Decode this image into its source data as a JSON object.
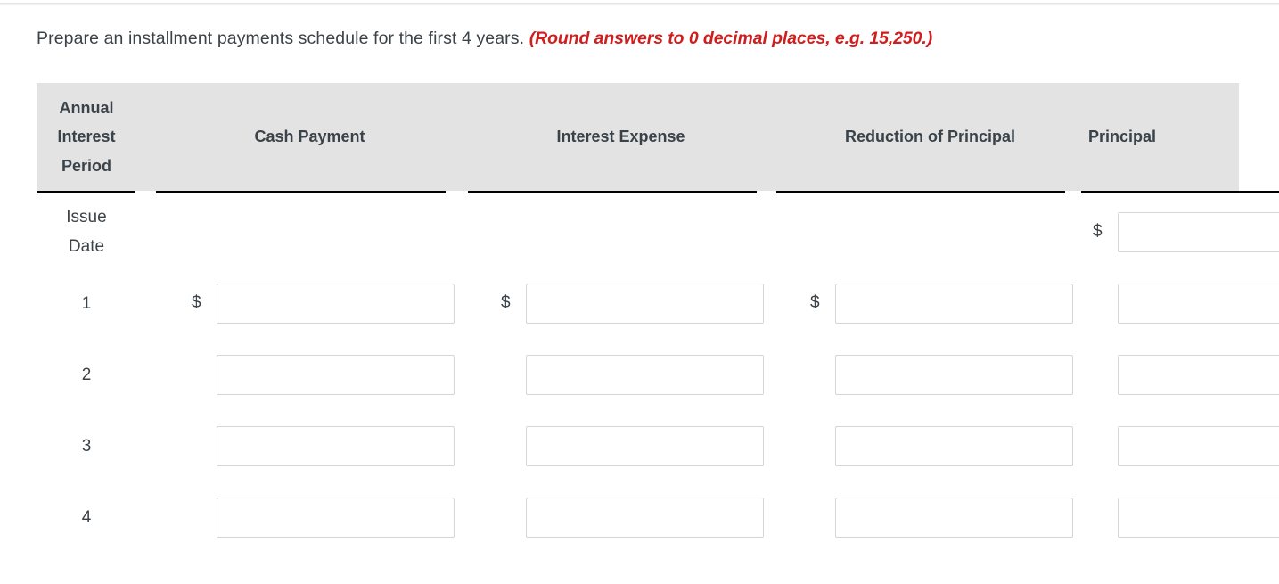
{
  "prompt": {
    "text": "Prepare an installment payments schedule for the first 4 years.",
    "note": "(Round answers to 0 decimal places, e.g. 15,250.)",
    "note_color": "#d01e1e"
  },
  "table": {
    "header_background": "#e3e3e3",
    "columns": [
      {
        "id": "period",
        "label": "Annual\nInterest\nPeriod",
        "lines": [
          "Annual",
          "Interest",
          "Period"
        ]
      },
      {
        "id": "cash",
        "label": "Cash Payment"
      },
      {
        "id": "interest",
        "label": "Interest Expense"
      },
      {
        "id": "reduction",
        "label": "Reduction of Principal"
      },
      {
        "id": "principal",
        "label": "Principal"
      }
    ],
    "rows": [
      {
        "label_lines": [
          "Issue",
          "Date"
        ],
        "cells": [
          {
            "column": "cash",
            "has_dollar": false,
            "has_input": false,
            "value": ""
          },
          {
            "column": "interest",
            "has_dollar": false,
            "has_input": false,
            "value": ""
          },
          {
            "column": "reduction",
            "has_dollar": false,
            "has_input": false,
            "value": ""
          },
          {
            "column": "principal",
            "has_dollar": true,
            "has_input": true,
            "value": ""
          }
        ]
      },
      {
        "label_lines": [
          "1"
        ],
        "cells": [
          {
            "column": "cash",
            "has_dollar": true,
            "has_input": true,
            "value": ""
          },
          {
            "column": "interest",
            "has_dollar": true,
            "has_input": true,
            "value": ""
          },
          {
            "column": "reduction",
            "has_dollar": true,
            "has_input": true,
            "value": ""
          },
          {
            "column": "principal",
            "has_dollar": false,
            "has_input": true,
            "value": ""
          }
        ]
      },
      {
        "label_lines": [
          "2"
        ],
        "cells": [
          {
            "column": "cash",
            "has_dollar": false,
            "has_input": true,
            "value": ""
          },
          {
            "column": "interest",
            "has_dollar": false,
            "has_input": true,
            "value": ""
          },
          {
            "column": "reduction",
            "has_dollar": false,
            "has_input": true,
            "value": ""
          },
          {
            "column": "principal",
            "has_dollar": false,
            "has_input": true,
            "value": ""
          }
        ]
      },
      {
        "label_lines": [
          "3"
        ],
        "cells": [
          {
            "column": "cash",
            "has_dollar": false,
            "has_input": true,
            "value": ""
          },
          {
            "column": "interest",
            "has_dollar": false,
            "has_input": true,
            "value": ""
          },
          {
            "column": "reduction",
            "has_dollar": false,
            "has_input": true,
            "value": ""
          },
          {
            "column": "principal",
            "has_dollar": false,
            "has_input": true,
            "value": ""
          }
        ]
      },
      {
        "label_lines": [
          "4"
        ],
        "cells": [
          {
            "column": "cash",
            "has_dollar": false,
            "has_input": true,
            "value": ""
          },
          {
            "column": "interest",
            "has_dollar": false,
            "has_input": true,
            "value": ""
          },
          {
            "column": "reduction",
            "has_dollar": false,
            "has_input": true,
            "value": ""
          },
          {
            "column": "principal",
            "has_dollar": false,
            "has_input": true,
            "value": ""
          }
        ]
      }
    ],
    "currency_symbol": "$"
  }
}
